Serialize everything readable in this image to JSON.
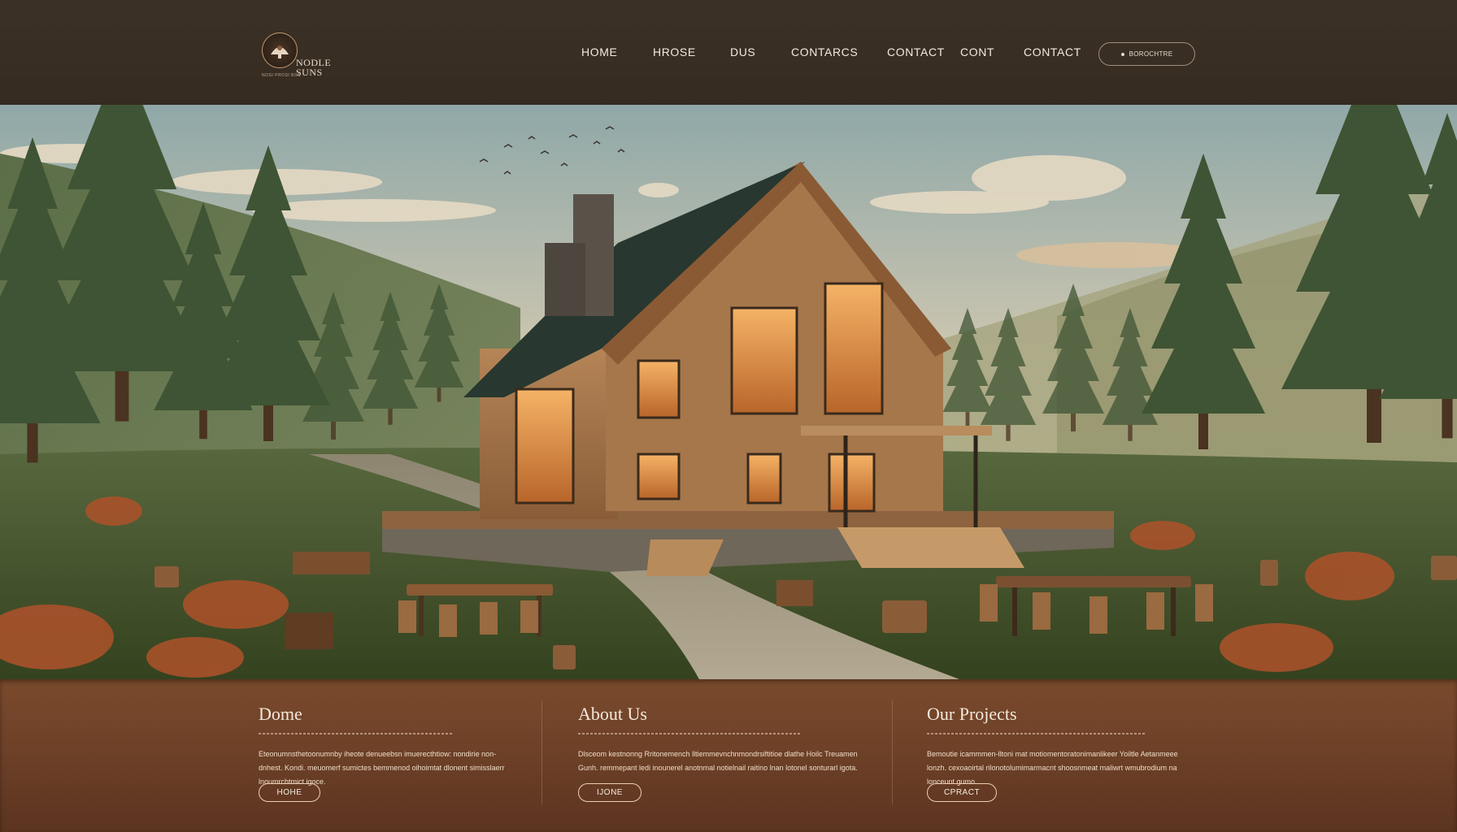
{
  "header": {
    "logo": {
      "name_line1": "NODLE",
      "name_line2": "SUNS",
      "tagline": "NOSI PROSI BOS"
    },
    "nav": [
      {
        "label": "HOME"
      },
      {
        "label": "HROSE"
      },
      {
        "label": "DUS"
      },
      {
        "label": "CONTARCS"
      },
      {
        "label": "CONTACT"
      },
      {
        "label": "CONT"
      },
      {
        "label": "CONTACT"
      }
    ],
    "cta_label": "BOROCHTRE"
  },
  "hero": {
    "scene_icons": [
      "pine-tree-icon",
      "cabin-house-icon",
      "birds-flock-icon",
      "picnic-table-icon",
      "chair-icon",
      "firewood-stack-icon",
      "tree-stump-icon"
    ]
  },
  "panels": [
    {
      "title": "Dome",
      "rule": "",
      "text": "Eteonumnsthetoonumnby iheote denueebsn imuerecthtiow: nondirie non-dnhest. Kondi. meuomerf sumictes bemmenod oihoimtat dlonent simisslaerr lnoumrchtmict igoce.",
      "button": "HOHE"
    },
    {
      "title": "About Us",
      "rule": "",
      "text": "Dlsceom kestnonng Rritonemench lltiemmevnchnmondrsiftitioe dlathe Hoilc Treuamen Gunh. remmepant ledi inounerel anotnmal notielnail raitino lnan lotonel sonturarl igota.",
      "button": "IJONE"
    },
    {
      "title": "Our Projects",
      "rule": "",
      "text": "Bemoutie icammmen-lltoni mat motiomentoratonimanlikeer Yoiltle Aetanmeee lonzh. cexoaoirtal rilonotolumimarmacnt shoosnmeat maliwrt wmubrodium na lonceunt gumo.",
      "button": "CPRACT"
    }
  ],
  "colors": {
    "header_bg": "#382e24",
    "footer_bg": "#6e4128",
    "accent": "#c99a6b",
    "nav_text": "#f2ebe1"
  }
}
